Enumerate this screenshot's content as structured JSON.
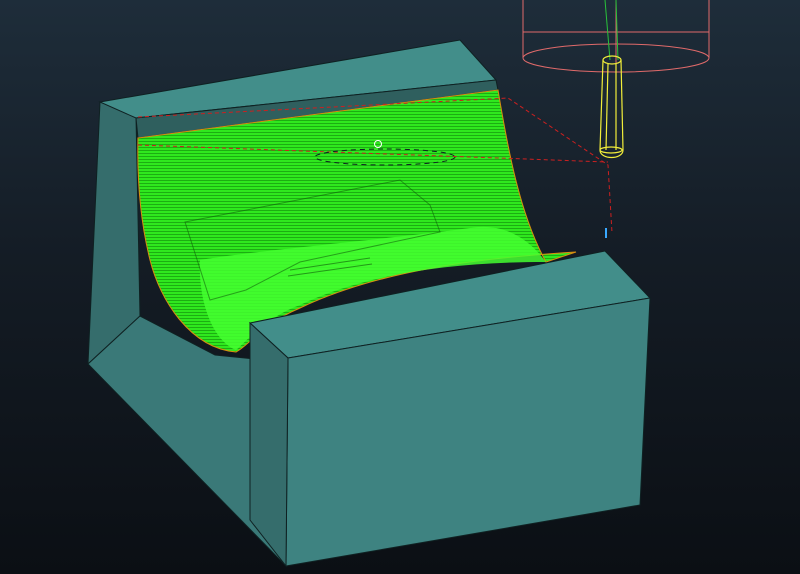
{
  "viewport": {
    "background_top": "#1e2d3a",
    "background_bottom": "#0b0f14"
  },
  "colors": {
    "stock_top": "#3f8a87",
    "stock_front": "#3d8280",
    "stock_side": "#356d6c",
    "stock_edge": "#0f2122",
    "toolpath": "#33ee22",
    "toolpath_dark": "#1aa812",
    "tool": "#f2ee3a",
    "holder": "#e06a6a",
    "link_move": "#cc2020",
    "shank_axis": "#29c23a"
  }
}
